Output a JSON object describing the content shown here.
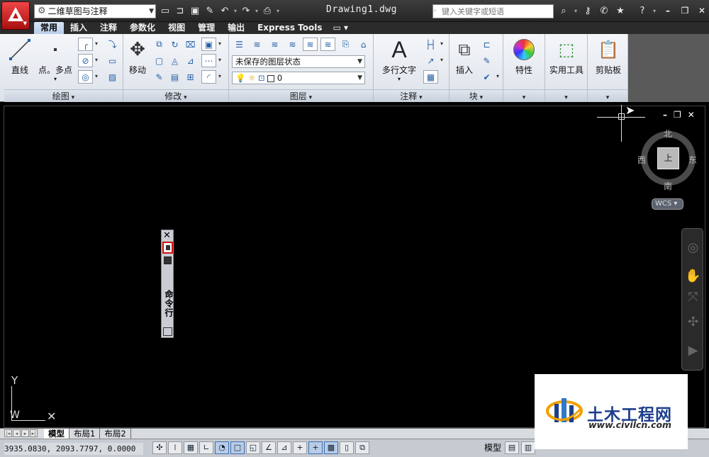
{
  "title_bar": {
    "workspace": "二维草图与注释",
    "document_title": "Drawing1.dwg",
    "search_placeholder": "键入关键字或短语",
    "qat_icons": [
      "new-icon",
      "open-icon",
      "save-icon",
      "saveas-icon",
      "undo-icon",
      "redo-icon",
      "plot-icon"
    ],
    "window_buttons": [
      "minimize",
      "restore",
      "close"
    ]
  },
  "tabs": [
    "常用",
    "插入",
    "注释",
    "参数化",
    "视图",
    "管理",
    "输出",
    "Express Tools"
  ],
  "active_tab": "常用",
  "ribbon": {
    "draw": {
      "title": "绘图",
      "line": "直线",
      "point": "点。多点"
    },
    "modify": {
      "title": "修改",
      "move": "移动"
    },
    "layers": {
      "title": "图层",
      "layer_state": "未保存的图层状态",
      "current_layer": "0"
    },
    "annotation": {
      "title": "注释",
      "mtext": "多行文字"
    },
    "block": {
      "title": "块",
      "insert": "插入"
    },
    "properties": {
      "label": "特性"
    },
    "utilities": {
      "label": "实用工具"
    },
    "clipboard": {
      "label": "剪贴板"
    }
  },
  "viewcube": {
    "north": "北",
    "south": "南",
    "east": "东",
    "west": "西",
    "face": "上",
    "wcs": "WCS"
  },
  "command_line": {
    "label": "命令行"
  },
  "ucs": {
    "y": "Y",
    "w": "W"
  },
  "layout_tabs": [
    "模型",
    "布局1",
    "布局2"
  ],
  "status": {
    "coordinates": "3935.0830,  2093.7797,  0.0000",
    "model_label": "模型"
  },
  "watermark": {
    "name": "土木工程网",
    "url": "www.civilcn.com"
  },
  "colors": {
    "app_red": "#c01818",
    "tab_active": "#c9dbf0",
    "canvas": "#000000",
    "watermark_blue": "#1d3f8c"
  }
}
